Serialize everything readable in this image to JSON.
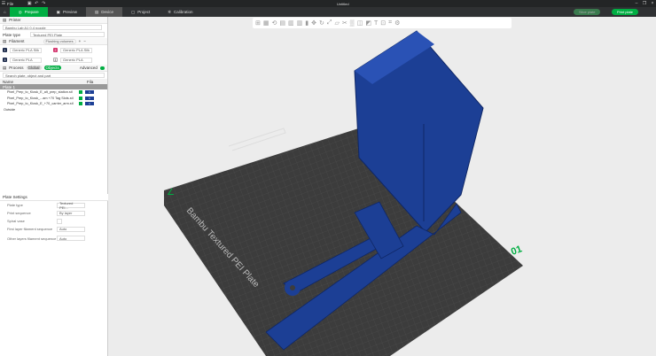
{
  "window": {
    "title": "Untitled",
    "menu": "File"
  },
  "tabs": [
    {
      "label": "Prepare"
    },
    {
      "label": "Preview"
    },
    {
      "label": "Device"
    },
    {
      "label": "Project"
    },
    {
      "label": "Calibration"
    }
  ],
  "actions": {
    "slice": "Slice plate",
    "print": "Print plate"
  },
  "printer": {
    "section": "Printer",
    "name": "Bambu Lab A1 0.4 nozzle",
    "plate_type_label": "Plate type",
    "plate_type": "Textured PEI Plate"
  },
  "filament": {
    "section": "Filament",
    "flushing": "Flushing volumes",
    "slots": [
      {
        "num": "1",
        "name": "Generic PLA Silk",
        "color": "#1c2a4a"
      },
      {
        "num": "2",
        "name": "Generic PLA Silk",
        "color": "#d4356e"
      },
      {
        "num": "3",
        "name": "Generic PLA",
        "color": "#1c2a4a"
      },
      {
        "num": "4",
        "name": "Generic PLA",
        "color": "#ffffff"
      }
    ]
  },
  "process": {
    "section": "Process",
    "global": "Global",
    "objects": "Objects",
    "advanced": "Advanced",
    "search_placeholder": "Search plate, object and part",
    "col_name": "Name",
    "col_fila": "Fila",
    "plate": "Plate 1",
    "objects_list": [
      {
        "name": "Pixel_Prep_to_Kiosk_E_alt_prep_station.stl",
        "fil": "1"
      },
      {
        "name": "Pixel_Prep_to_Kiosk_...am +70 Tag Slots.stl",
        "fil": "1"
      },
      {
        "name": "Pixel_Prep_to_Kiosk_E_+70_carrier_arm.stl",
        "fil": "1"
      }
    ],
    "outside": "Outside"
  },
  "plate_settings": {
    "title": "Plate Settings",
    "rows": [
      {
        "label": "Plate type",
        "value": "Textured PEI..."
      },
      {
        "label": "Print sequence",
        "value": "By layer"
      },
      {
        "label": "Spiral vase",
        "value": ""
      },
      {
        "label": "First layer filament sequence",
        "value": "Auto"
      },
      {
        "label": "Other layers filament sequence",
        "value": "Auto"
      }
    ]
  },
  "viewport": {
    "plate_label": "Bambu Textured PEI Plate",
    "plate_number": "01"
  },
  "colors": {
    "accent": "#00ae42",
    "model": "#1c3f95"
  }
}
